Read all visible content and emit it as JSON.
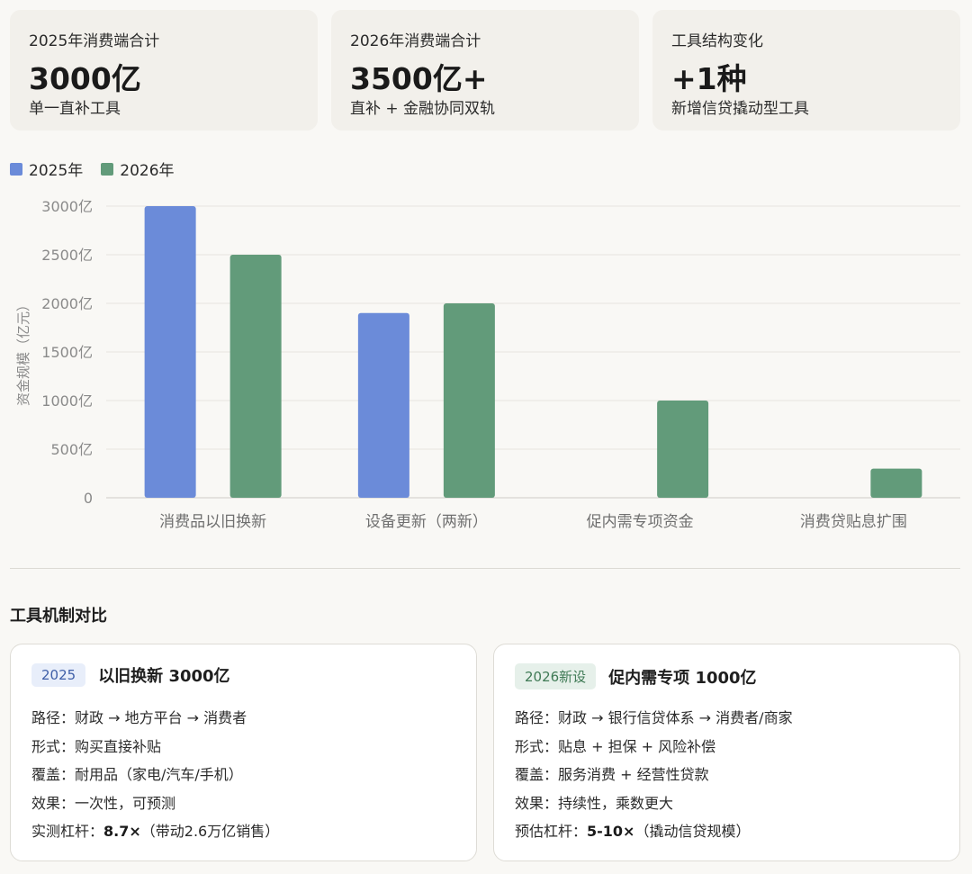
{
  "summary_cards": [
    {
      "label": "2025年消费端合计",
      "value": "3000亿",
      "sub": "单一直补工具"
    },
    {
      "label": "2026年消费端合计",
      "value": "3500亿+",
      "sub": "直补 + 金融协同双轨"
    },
    {
      "label": "工具结构变化",
      "value": "+1种",
      "sub": "新增信贷撬动型工具"
    }
  ],
  "colors": {
    "y2025": "#6b8bd9",
    "y2026": "#629b7a",
    "grid": "#e6e4df",
    "axis": "#8a8a8a"
  },
  "chart_data": {
    "type": "bar",
    "categories": [
      "消费品以旧换新",
      "设备更新（两新）",
      "促内需专项资金",
      "消费贷贴息扩围"
    ],
    "series": [
      {
        "name": "2025年",
        "values": [
          3000,
          1900,
          null,
          null
        ]
      },
      {
        "name": "2026年",
        "values": [
          2500,
          2000,
          1000,
          300
        ]
      }
    ],
    "ylabel": "资金规模（亿元）",
    "ylim": [
      0,
      3000
    ],
    "yticks": [
      0,
      500,
      1000,
      1500,
      2000,
      2500,
      3000
    ],
    "ytick_labels": [
      "0",
      "500亿",
      "1000亿",
      "1500亿",
      "2000亿",
      "2500亿",
      "3000亿"
    ],
    "grid": true,
    "legend_position": "top-left"
  },
  "section_title": "工具机制对比",
  "mechanisms": [
    {
      "badge": "2025",
      "title": "以旧换新 3000亿",
      "rows": [
        {
          "label": "路径：",
          "text": "财政 → 地方平台 → 消费者",
          "bold": "",
          "tail": ""
        },
        {
          "label": "形式：",
          "text": "购买直接补贴",
          "bold": "",
          "tail": ""
        },
        {
          "label": "覆盖：",
          "text": "耐用品（家电/汽车/手机）",
          "bold": "",
          "tail": ""
        },
        {
          "label": "效果：",
          "text": "一次性，可预测",
          "bold": "",
          "tail": ""
        },
        {
          "label": "实测杠杆：",
          "text": "",
          "bold": "8.7×",
          "tail": "（带动2.6万亿销售）"
        }
      ]
    },
    {
      "badge": "2026新设",
      "title": "促内需专项 1000亿",
      "rows": [
        {
          "label": "路径：",
          "text": "财政 → 银行信贷体系 → 消费者/商家",
          "bold": "",
          "tail": ""
        },
        {
          "label": "形式：",
          "text": "贴息 + 担保 + 风险补偿",
          "bold": "",
          "tail": ""
        },
        {
          "label": "覆盖：",
          "text": "服务消费 + 经营性贷款",
          "bold": "",
          "tail": ""
        },
        {
          "label": "效果：",
          "text": "持续性，乘数更大",
          "bold": "",
          "tail": ""
        },
        {
          "label": "预估杠杆：",
          "text": "",
          "bold": "5-10×",
          "tail": "（撬动信贷规模）"
        }
      ]
    }
  ]
}
